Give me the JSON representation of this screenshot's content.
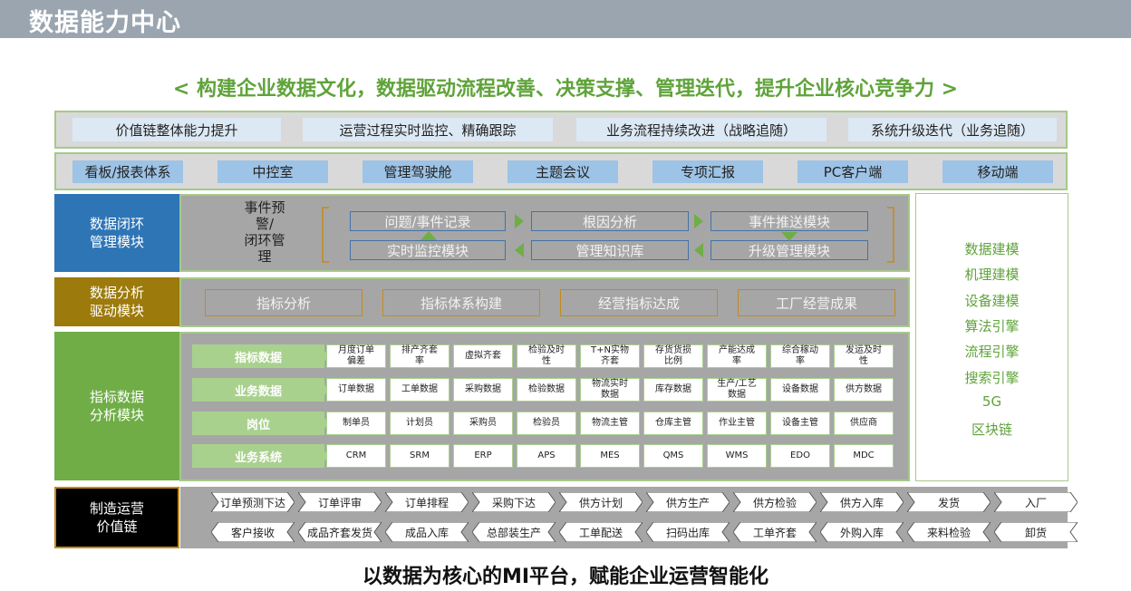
{
  "page_title": "数据能力中心",
  "slogan": "<  构建企业数据文化，数据驱动流程改善、决策支撑、管理迭代，提升企业核心竞争力   >",
  "row1": [
    "价值链整体能力提升",
    "运营过程实时监控、精确跟踪",
    "业务流程持续改进（战略追随）",
    "系统升级迭代（业务追随）"
  ],
  "row2": [
    "看板/报表体系",
    "中控室",
    "管理驾驶舱",
    "主题会议",
    "专项汇报",
    "PC客户端",
    "移动端"
  ],
  "closed_loop": {
    "label": "数据闭环\n管理模块",
    "event_label": [
      "事件预",
      "警/",
      "闭环管",
      "理"
    ],
    "top_flow": [
      "问题/事件记录",
      "根因分析",
      "事件推送模块"
    ],
    "bottom_flow": [
      "实时监控模块",
      "管理知识库",
      "升级管理模块"
    ]
  },
  "analysis": {
    "label": "数据分析\n驱动模块",
    "items": [
      "指标分析",
      "指标体系构建",
      "经营指标达成",
      "工厂经营成果"
    ]
  },
  "indicator": {
    "label": "指标数据\n分析模块",
    "rows": [
      {
        "category": "指标数据",
        "cells": [
          "月度订单\n偏差",
          "排产齐套\n率",
          "虚拟齐套",
          "检验及时\n性",
          "T+N实物\n齐套",
          "存货货损\n比例",
          "产能达成\n率",
          "综合稼动\n率",
          "发运及时\n性"
        ]
      },
      {
        "category": "业务数据",
        "cells": [
          "订单数据",
          "工单数据",
          "采购数据",
          "检验数据",
          "物流实时\n数据",
          "库存数据",
          "生产/工艺\n数据",
          "设备数据",
          "供方数据"
        ]
      },
      {
        "category": "岗位",
        "cells": [
          "制单员",
          "计划员",
          "采购员",
          "检验员",
          "物流主管",
          "仓库主管",
          "作业主管",
          "设备主管",
          "供应商"
        ]
      },
      {
        "category": "业务系统",
        "cells": [
          "CRM",
          "SRM",
          "ERP",
          "APS",
          "MES",
          "QMS",
          "WMS",
          "EDO",
          "MDC"
        ]
      }
    ]
  },
  "side_items": [
    "数据建模",
    "机理建模",
    "设备建模",
    "算法引擎",
    "流程引擎",
    "搜索引擎",
    "5G",
    "区块链"
  ],
  "value_chain": {
    "label": "制造运营\n价值链",
    "forward": [
      "订单预测下达",
      "订单评审",
      "订单排程",
      "采购下达",
      "供方计划",
      "供方生产",
      "供方检验",
      "供方入库",
      "发货",
      "入厂"
    ],
    "backward": [
      "客户接收",
      "成品齐套发货",
      "成品入库",
      "总部装生产",
      "工单配送",
      "扫码出库",
      "工单齐套",
      "外购入库",
      "来料检验",
      "卸货"
    ]
  },
  "bottom_text": "以数据为核心的MI平台，赋能企业运营智能化",
  "colors": {
    "title_bar": "#9aa5b0",
    "accent_green": "#5fa33a",
    "closed_loop": "#2e75b6",
    "analysis": "#9c7a0c",
    "indicator": "#70ad47",
    "value_chain": "#000000",
    "gray_area": "#a6a6a6"
  }
}
